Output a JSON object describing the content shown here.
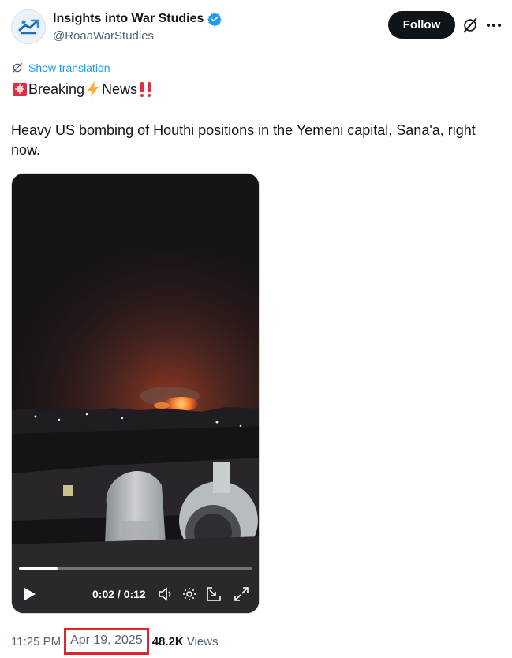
{
  "author": {
    "name": "Insights into War Studies",
    "handle": "@RoaaWarStudies",
    "verified": true
  },
  "follow_label": "Follow",
  "translation_label": "Show translation",
  "breaking": {
    "word1": "Breaking",
    "word2": "News",
    "emojis": [
      "rotating-light-icon",
      "lightning-icon",
      "double-exclamation-icon"
    ]
  },
  "tweet_text": "Heavy US bombing of Houthi positions in the Yemeni capital, Sana'a, right now.",
  "video": {
    "current_time": "0:02",
    "duration": "0:12",
    "time_display": "0:02 / 0:12",
    "progress": 0.167
  },
  "meta": {
    "time": "11:25 PM",
    "date": "Apr 19, 2025",
    "views_count": "48.2K",
    "views_label": "Views"
  },
  "colors": {
    "follow_bg": "#0f1419",
    "link_blue": "#1d9bf0",
    "verified_blue": "#1d9bf0",
    "highlight_red": "#e3242b",
    "secondary_text": "#536471"
  }
}
